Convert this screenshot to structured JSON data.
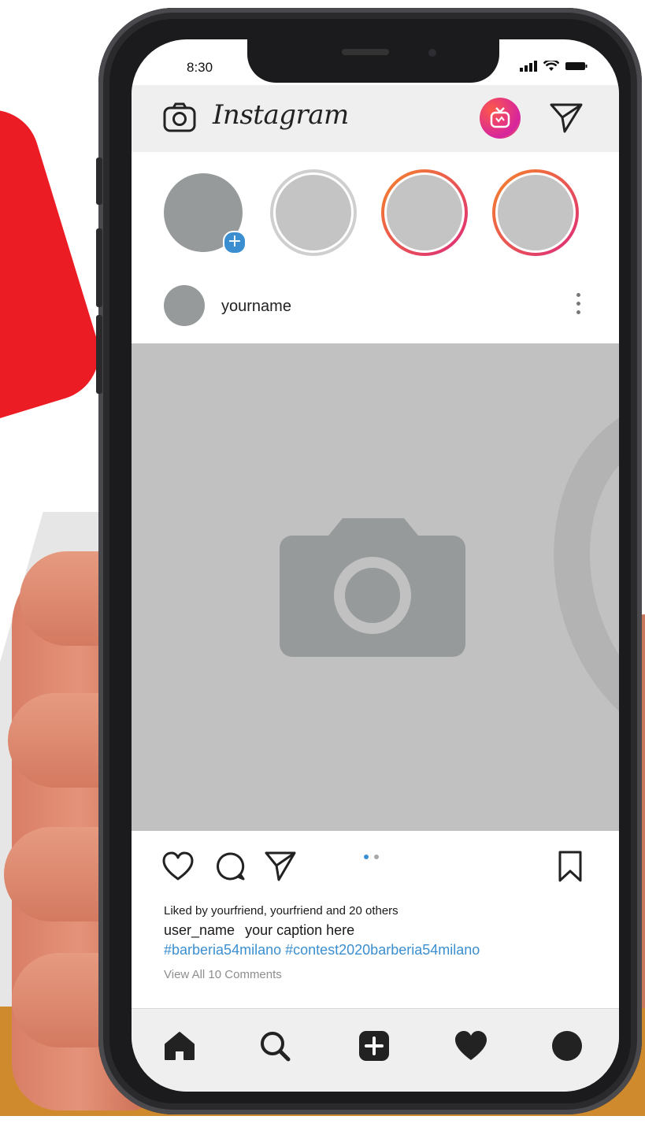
{
  "status_bar": {
    "time": "8:30"
  },
  "header": {
    "title": "Instagram",
    "icons": {
      "camera": "camera-icon",
      "igtv": "igtv-icon",
      "direct": "direct-message-icon"
    }
  },
  "stories": [
    {
      "id": "your-story",
      "ring": "none",
      "add_badge": "+"
    },
    {
      "id": "story-2",
      "ring": "seen"
    },
    {
      "id": "story-3",
      "ring": "unseen"
    },
    {
      "id": "story-4",
      "ring": "unseen"
    }
  ],
  "post": {
    "username": "yourname",
    "image_placeholder": "camera-icon",
    "carousel_dots": 2,
    "liked_by": "Liked by yourfriend, yourfriend and 20 others",
    "caption_user": "user_name",
    "caption_text": "your caption here",
    "hashtags": "#barberia54milano #contest2020barberia54milano",
    "view_comments": "View All 10 Comments"
  },
  "bottom_nav": [
    {
      "id": "home",
      "icon": "home-icon"
    },
    {
      "id": "search",
      "icon": "search-icon"
    },
    {
      "id": "add",
      "icon": "add-post-icon"
    },
    {
      "id": "activity",
      "icon": "heart-icon"
    },
    {
      "id": "profile",
      "icon": "profile-icon"
    }
  ],
  "colors": {
    "accent_blue": "#3b8fd0",
    "story_ring_start": "#f58529",
    "story_ring_end": "#dd2a7b",
    "placeholder_grey": "#979a9b",
    "background_red": "#ec1c24",
    "background_orange": "#ce8a2c"
  }
}
